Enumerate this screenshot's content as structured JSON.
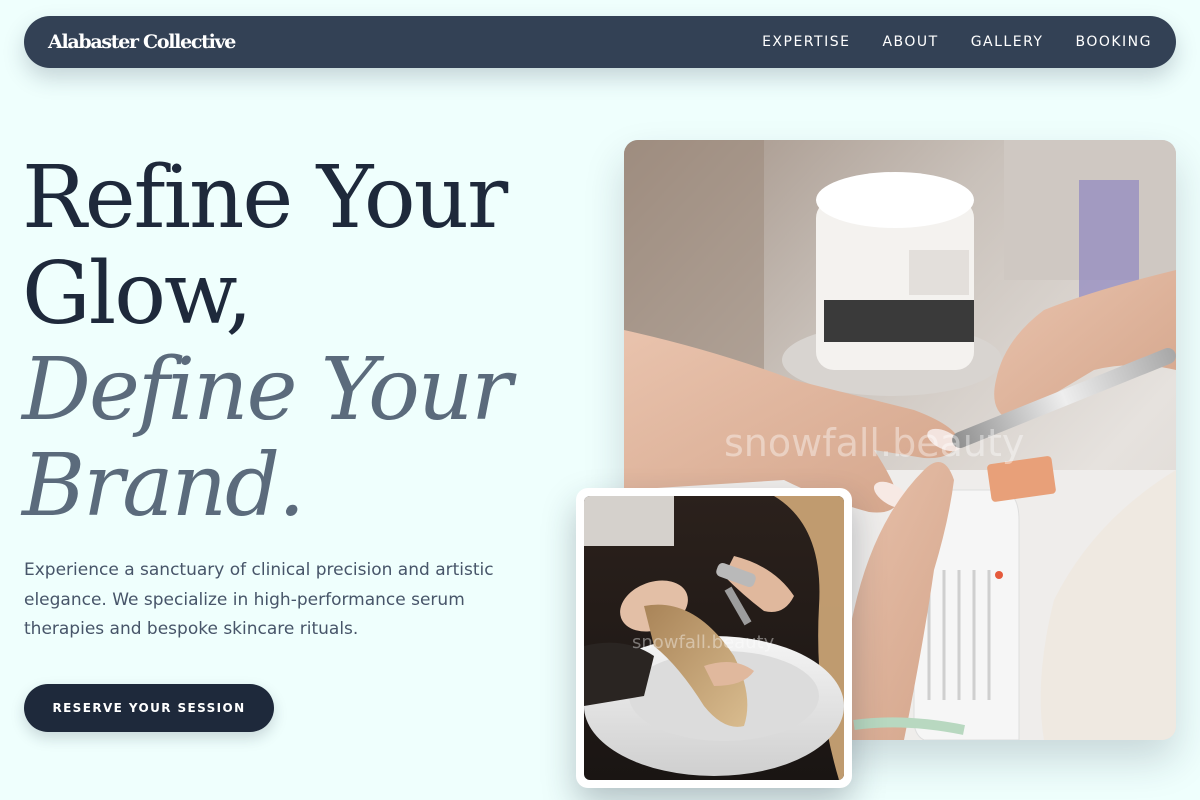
{
  "brand": {
    "name": "Alabaster Collective"
  },
  "nav": {
    "links": [
      {
        "label": "EXPERTISE"
      },
      {
        "label": "ABOUT"
      },
      {
        "label": "GALLERY"
      },
      {
        "label": "BOOKING"
      }
    ]
  },
  "hero": {
    "headline": {
      "line1": "Refine Your",
      "line2": "Glow,",
      "line3": "Define Your",
      "line4": "Brand."
    },
    "description": "Experience a sanctuary of clinical precision and artistic elegance. We specialize in high-performance serum therapies and bespoke skincare rituals.",
    "cta_label": "RESERVE YOUR SESSION"
  },
  "images": {
    "main_watermark": "snowfall.beauty",
    "inset_watermark": "snowfall.beauty"
  },
  "colors": {
    "page_background": "#effffd",
    "nav_background": "#334155",
    "heading_dark": "#1e293b",
    "heading_muted": "#5b6b7c",
    "cta_background": "#1e293b"
  }
}
